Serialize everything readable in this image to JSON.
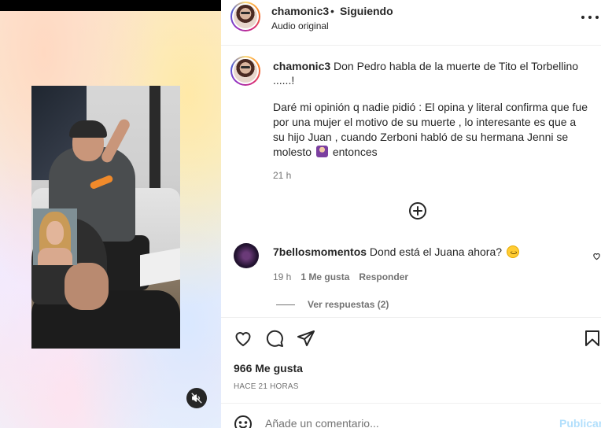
{
  "header": {
    "username": "chamonic3",
    "separator": "•",
    "follow_label": "Siguiendo",
    "audio_label": "Audio original"
  },
  "caption": {
    "username": "chamonic3",
    "text_1": "Don Pedro habla de la muerte de Tito el Torbellino ......!",
    "text_2_before_emoji": "Daré mi opinión q nadie pidió : El opina y literal confirma que fue por una mujer el motivo de su muerte , lo interesante es que a su hijo Juan , cuando Zerboni habló de su hermana Jenni se molesto",
    "text_2_after_emoji": "entonces",
    "time": "21 h"
  },
  "comment": {
    "username": "7bellosmomentos",
    "text": "Dond está el Juana ahora?",
    "time": "19 h",
    "likes": "1 Me gusta",
    "reply_label": "Responder",
    "view_replies": "Ver respuestas (2)"
  },
  "post": {
    "likes": "966 Me gusta",
    "time": "HACE 21 HORAS"
  },
  "add_comment": {
    "placeholder": "Añade un comentario...",
    "post_label": "Publicar"
  },
  "icons": {
    "mute": "speaker-muted-icon",
    "more": "more-horizontal-icon",
    "load_more": "plus-circle-icon",
    "like": "heart-icon",
    "comment": "comment-bubble-icon",
    "share": "paper-plane-icon",
    "save": "bookmark-icon",
    "emoji": "smiley-icon"
  },
  "colors": {
    "text": "#262626",
    "secondary": "#737373",
    "post_button": "#b2dffc",
    "divider": "#efefef"
  }
}
